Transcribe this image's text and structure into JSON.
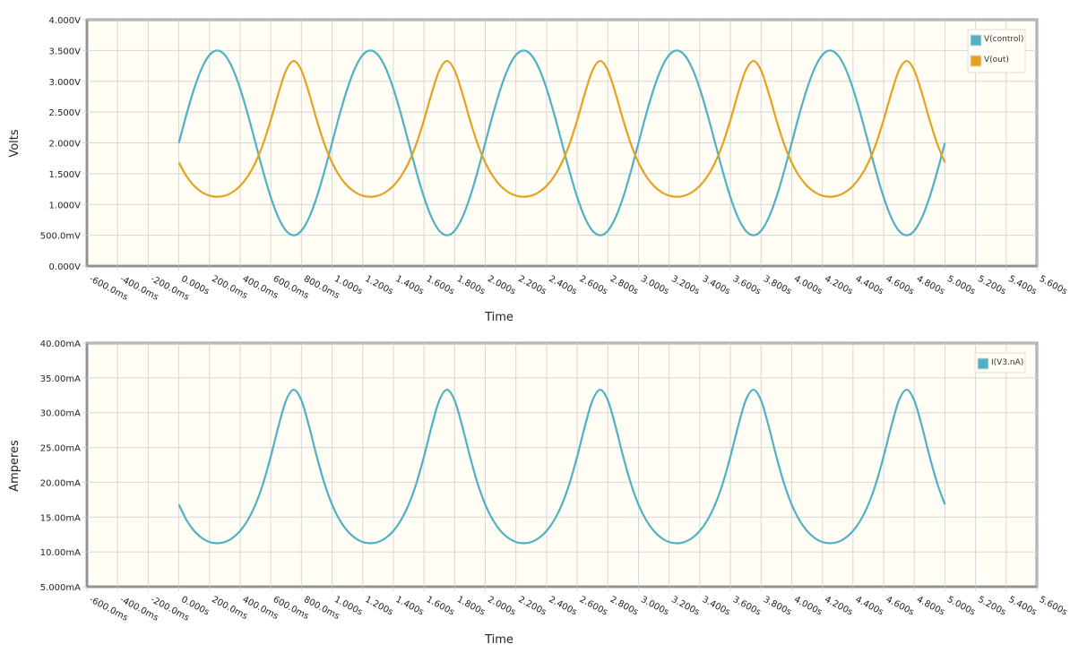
{
  "colors": {
    "teal": "#4fb1c4",
    "orange": "#e5a21e",
    "plot_bg": "#fffdf4",
    "grid": "#d6d6d6",
    "frame": "#9a9a9a"
  },
  "chart_data": [
    {
      "type": "line",
      "xlabel": "Time",
      "ylabel": "Volts",
      "xlim_ms": [
        -600,
        5600
      ],
      "ylim": [
        0,
        4
      ],
      "grid": true,
      "legend_position": "top-right",
      "x_ticks": [
        "-600.0ms",
        "-400.0ms",
        "-200.0ms",
        "0.000s",
        "200.0ms",
        "400.0ms",
        "600.0ms",
        "800.0ms",
        "1.000s",
        "1.200s",
        "1.400s",
        "1.600s",
        "1.800s",
        "2.000s",
        "2.200s",
        "2.400s",
        "2.600s",
        "2.800s",
        "3.000s",
        "3.200s",
        "3.400s",
        "3.600s",
        "3.800s",
        "4.000s",
        "4.200s",
        "4.400s",
        "4.600s",
        "4.800s",
        "5.000s",
        "5.200s",
        "5.400s",
        "5.600s"
      ],
      "y_ticks": [
        "0.000V",
        "500.0mV",
        "1.000V",
        "1.500V",
        "2.000V",
        "2.500V",
        "3.000V",
        "3.500V",
        "4.000V"
      ],
      "x_ms": [
        0,
        50,
        100,
        150,
        200,
        250,
        300,
        350,
        400,
        450,
        500,
        550,
        600,
        650,
        700,
        750,
        800,
        850,
        900,
        950,
        1000,
        1050,
        1100,
        1150,
        1200,
        1250,
        1300,
        1350,
        1400,
        1450,
        1500,
        1550,
        1600,
        1650,
        1700,
        1750,
        1800,
        1850,
        1900,
        1950,
        2000,
        2050,
        2100,
        2150,
        2200,
        2250,
        2300,
        2350,
        2400,
        2450,
        2500,
        2550,
        2600,
        2650,
        2700,
        2750,
        2800,
        2850,
        2900,
        2950,
        3000,
        3050,
        3100,
        3150,
        3200,
        3250,
        3300,
        3350,
        3400,
        3450,
        3500,
        3550,
        3600,
        3650,
        3700,
        3750,
        3800,
        3850,
        3900,
        3950,
        4000,
        4050,
        4100,
        4150,
        4200,
        4250,
        4300,
        4350,
        4400,
        4450,
        4500,
        4550,
        4600,
        4650,
        4700,
        4750,
        4800,
        4850,
        4900,
        4950,
        5000
      ],
      "series": [
        {
          "name": "V(control)",
          "color": "#4fb1c4",
          "values": [
            2.0,
            2.464,
            2.882,
            3.214,
            3.427,
            3.5,
            3.427,
            3.214,
            2.882,
            2.464,
            2.0,
            1.536,
            1.118,
            0.786,
            0.573,
            0.5,
            0.573,
            0.786,
            1.118,
            1.536,
            2.0,
            2.464,
            2.882,
            3.214,
            3.427,
            3.5,
            3.427,
            3.214,
            2.882,
            2.464,
            2.0,
            1.536,
            1.118,
            0.786,
            0.573,
            0.5,
            0.573,
            0.786,
            1.118,
            1.536,
            2.0,
            2.464,
            2.882,
            3.214,
            3.427,
            3.5,
            3.427,
            3.214,
            2.882,
            2.464,
            2.0,
            1.536,
            1.118,
            0.786,
            0.573,
            0.5,
            0.573,
            0.786,
            1.118,
            1.536,
            2.0,
            2.464,
            2.882,
            3.214,
            3.427,
            3.5,
            3.427,
            3.214,
            2.882,
            2.464,
            2.0,
            1.536,
            1.118,
            0.786,
            0.573,
            0.5,
            0.573,
            0.786,
            1.118,
            1.536,
            2.0,
            2.464,
            2.882,
            3.214,
            3.427,
            3.5,
            3.427,
            3.214,
            2.882,
            2.464,
            2.0,
            1.536,
            1.118,
            0.786,
            0.573,
            0.5,
            0.573,
            0.786,
            1.118,
            1.536,
            2.0
          ]
        },
        {
          "name": "V(out)",
          "color": "#e5a21e",
          "values": [
            1.68,
            1.457,
            1.301,
            1.2,
            1.142,
            1.124,
            1.142,
            1.2,
            1.301,
            1.457,
            1.68,
            1.984,
            2.371,
            2.804,
            3.177,
            3.33,
            3.177,
            2.804,
            2.371,
            1.984,
            1.68,
            1.457,
            1.301,
            1.2,
            1.142,
            1.124,
            1.142,
            1.2,
            1.301,
            1.457,
            1.68,
            1.984,
            2.371,
            2.804,
            3.177,
            3.33,
            3.177,
            2.804,
            2.371,
            1.984,
            1.68,
            1.457,
            1.301,
            1.2,
            1.142,
            1.124,
            1.142,
            1.2,
            1.301,
            1.457,
            1.68,
            1.984,
            2.371,
            2.804,
            3.177,
            3.33,
            3.177,
            2.804,
            2.371,
            1.984,
            1.68,
            1.457,
            1.301,
            1.2,
            1.142,
            1.124,
            1.142,
            1.2,
            1.301,
            1.457,
            1.68,
            1.984,
            2.371,
            2.804,
            3.177,
            3.33,
            3.177,
            2.804,
            2.371,
            1.984,
            1.68,
            1.457,
            1.301,
            1.2,
            1.142,
            1.124,
            1.142,
            1.2,
            1.301,
            1.457,
            1.68,
            1.984,
            2.371,
            2.804,
            3.177,
            3.33,
            3.177,
            2.804,
            2.371,
            1.984,
            1.68
          ]
        }
      ]
    },
    {
      "type": "line",
      "xlabel": "Time",
      "ylabel": "Amperes",
      "xlim_ms": [
        -600,
        5600
      ],
      "ylim_mA": [
        5,
        40
      ],
      "grid": true,
      "legend_position": "top-right",
      "x_ticks": [
        "-600.0ms",
        "-400.0ms",
        "-200.0ms",
        "0.000s",
        "200.0ms",
        "400.0ms",
        "600.0ms",
        "800.0ms",
        "1.000s",
        "1.200s",
        "1.400s",
        "1.600s",
        "1.800s",
        "2.000s",
        "2.200s",
        "2.400s",
        "2.600s",
        "2.800s",
        "3.000s",
        "3.200s",
        "3.400s",
        "3.600s",
        "3.800s",
        "4.000s",
        "4.200s",
        "4.400s",
        "4.600s",
        "4.800s",
        "5.000s",
        "5.200s",
        "5.400s",
        "5.600s"
      ],
      "y_ticks": [
        "5.000mA",
        "10.00mA",
        "15.00mA",
        "20.00mA",
        "25.00mA",
        "30.00mA",
        "35.00mA",
        "40.00mA"
      ],
      "x_ms": [
        0,
        50,
        100,
        150,
        200,
        250,
        300,
        350,
        400,
        450,
        500,
        550,
        600,
        650,
        700,
        750,
        800,
        850,
        900,
        950,
        1000,
        1050,
        1100,
        1150,
        1200,
        1250,
        1300,
        1350,
        1400,
        1450,
        1500,
        1550,
        1600,
        1650,
        1700,
        1750,
        1800,
        1850,
        1900,
        1950,
        2000,
        2050,
        2100,
        2150,
        2200,
        2250,
        2300,
        2350,
        2400,
        2450,
        2500,
        2550,
        2600,
        2650,
        2700,
        2750,
        2800,
        2850,
        2900,
        2950,
        3000,
        3050,
        3100,
        3150,
        3200,
        3250,
        3300,
        3350,
        3400,
        3450,
        3500,
        3550,
        3600,
        3650,
        3700,
        3750,
        3800,
        3850,
        3900,
        3950,
        4000,
        4050,
        4100,
        4150,
        4200,
        4250,
        4300,
        4350,
        4400,
        4450,
        4500,
        4550,
        4600,
        4650,
        4700,
        4750,
        4800,
        4850,
        4900,
        4950,
        5000
      ],
      "series": [
        {
          "name": "I(V3.nA)",
          "color": "#4fb1c4",
          "values": [
            16.8,
            14.57,
            13.01,
            12.0,
            11.42,
            11.24,
            11.42,
            12.0,
            13.01,
            14.57,
            16.8,
            19.84,
            23.71,
            28.04,
            31.77,
            33.3,
            31.77,
            28.04,
            23.71,
            19.84,
            16.8,
            14.57,
            13.01,
            12.0,
            11.42,
            11.24,
            11.42,
            12.0,
            13.01,
            14.57,
            16.8,
            19.84,
            23.71,
            28.04,
            31.77,
            33.3,
            31.77,
            28.04,
            23.71,
            19.84,
            16.8,
            14.57,
            13.01,
            12.0,
            11.42,
            11.24,
            11.42,
            12.0,
            13.01,
            14.57,
            16.8,
            19.84,
            23.71,
            28.04,
            31.77,
            33.3,
            31.77,
            28.04,
            23.71,
            19.84,
            16.8,
            14.57,
            13.01,
            12.0,
            11.42,
            11.24,
            11.42,
            12.0,
            13.01,
            14.57,
            16.8,
            19.84,
            23.71,
            28.04,
            31.77,
            33.3,
            31.77,
            28.04,
            23.71,
            19.84,
            16.8,
            14.57,
            13.01,
            12.0,
            11.42,
            11.24,
            11.42,
            12.0,
            13.01,
            14.57,
            16.8,
            19.84,
            23.71,
            28.04,
            31.77,
            33.3,
            31.77,
            28.04,
            23.71,
            19.84,
            16.8
          ]
        }
      ]
    }
  ]
}
